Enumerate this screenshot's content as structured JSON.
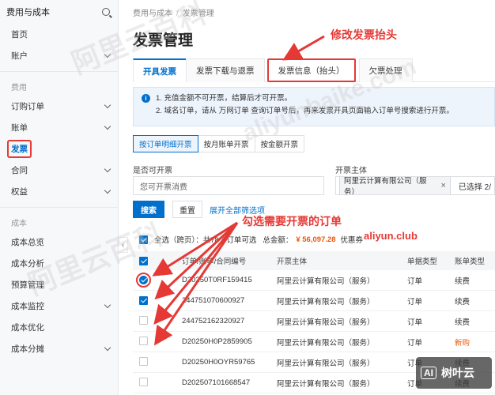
{
  "sidebar": {
    "title": "费用与成本",
    "items": [
      {
        "label": "首页",
        "chevron": false
      },
      {
        "label": "账户",
        "chevron": true
      }
    ],
    "group_fee": "费用",
    "fee_items": [
      {
        "label": "订购订单",
        "chevron": true
      },
      {
        "label": "账单",
        "chevron": true
      },
      {
        "label": "发票",
        "chevron": false,
        "active": true
      },
      {
        "label": "合同",
        "chevron": true
      },
      {
        "label": "权益",
        "chevron": true
      }
    ],
    "group_cost": "成本",
    "cost_items": [
      {
        "label": "成本总览",
        "chevron": false
      },
      {
        "label": "成本分析",
        "chevron": false
      },
      {
        "label": "预算管理",
        "chevron": false
      },
      {
        "label": "成本监控",
        "chevron": true
      },
      {
        "label": "成本优化",
        "chevron": false
      },
      {
        "label": "成本分摊",
        "chevron": true
      }
    ],
    "collapse_glyph": "‹"
  },
  "breadcrumb": {
    "root": "费用与成本",
    "sep": "/",
    "current": "发票管理"
  },
  "page_title": "发票管理",
  "tabs": [
    {
      "label": "开具发票",
      "active": true
    },
    {
      "label": "发票下载与退票"
    },
    {
      "label": "发票信息（抬头）",
      "highlight": true
    },
    {
      "label": "欠票处理"
    }
  ],
  "notice": {
    "line1": "1. 充值金额不可开票，结算后才可开票。",
    "line2": "2. 域名订单，请从 万网订单 查询订单号后，再来发票开具页面输入订单号搜索进行开票。"
  },
  "subtabs": [
    {
      "label": "按订单明细开票",
      "active": true
    },
    {
      "label": "按月账单开票"
    },
    {
      "label": "按金额开票"
    }
  ],
  "filters": {
    "invoiceable_label": "是否可开票",
    "invoiceable_placeholder": "您可开票消费",
    "entity_label": "开票主体",
    "entity_tag": "阿里云计算有限公司（服务）",
    "entity_tag_close": "×",
    "selected_count": "已选择 2/"
  },
  "buttons": {
    "search": "搜索",
    "reset": "重置",
    "expand": "展开全部筛选项"
  },
  "selection": {
    "text": "全选（跨页）：共78个订单可选",
    "total_label": "总金额：",
    "total": "¥ 56,097.28",
    "coupon": "优惠券"
  },
  "table": {
    "headers": [
      "订单/账单/合同编号",
      "开票主体",
      "单据类型",
      "账单类型"
    ],
    "rows": [
      {
        "id": "D20250T0RF159415",
        "entity": "阿里云计算有限公司（服务）",
        "doc": "订单",
        "bill": "续费",
        "checked": true,
        "ring": true
      },
      {
        "id": "244751070600927",
        "entity": "阿里云计算有限公司（服务）",
        "doc": "订单",
        "bill": "续费",
        "checked": true
      },
      {
        "id": "244752162320927",
        "entity": "阿里云计算有限公司（服务）",
        "doc": "订单",
        "bill": "续费",
        "checked": false
      },
      {
        "id": "D20250H0P2859905",
        "entity": "阿里云计算有限公司（服务）",
        "doc": "订单",
        "bill": "新购",
        "checked": false,
        "new": true
      },
      {
        "id": "D20250H0OYR59765",
        "entity": "阿里云计算有限公司（服务）",
        "doc": "订单",
        "bill": "续费",
        "checked": false
      },
      {
        "id": "D202507101668547",
        "entity": "阿里云计算有限公司（服务）",
        "doc": "订单",
        "bill": "续费",
        "checked": false
      }
    ]
  },
  "annotations": {
    "edit_header": "修改发票抬头",
    "select_orders": "勾选需要开票的订单",
    "site": "aliyun.club"
  },
  "watermarks": [
    "阿里云百科",
    "aliyunbaike.com",
    "阿里云百科"
  ],
  "brand": {
    "ai": "AI",
    "name": "树叶云"
  },
  "colors": {
    "primary": "#0070cc",
    "annotation": "#e53935",
    "amount": "#e8590c"
  }
}
